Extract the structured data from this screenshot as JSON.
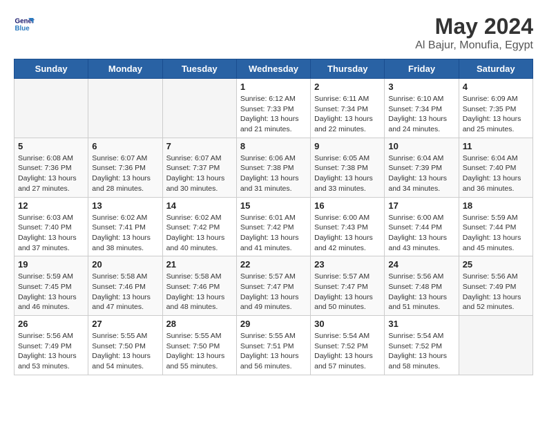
{
  "header": {
    "logo_line1": "General",
    "logo_line2": "Blue",
    "month_year": "May 2024",
    "location": "Al Bajur, Monufia, Egypt"
  },
  "days_of_week": [
    "Sunday",
    "Monday",
    "Tuesday",
    "Wednesday",
    "Thursday",
    "Friday",
    "Saturday"
  ],
  "weeks": [
    [
      {
        "day": "",
        "info": ""
      },
      {
        "day": "",
        "info": ""
      },
      {
        "day": "",
        "info": ""
      },
      {
        "day": "1",
        "info": "Sunrise: 6:12 AM\nSunset: 7:33 PM\nDaylight: 13 hours and 21 minutes."
      },
      {
        "day": "2",
        "info": "Sunrise: 6:11 AM\nSunset: 7:34 PM\nDaylight: 13 hours and 22 minutes."
      },
      {
        "day": "3",
        "info": "Sunrise: 6:10 AM\nSunset: 7:34 PM\nDaylight: 13 hours and 24 minutes."
      },
      {
        "day": "4",
        "info": "Sunrise: 6:09 AM\nSunset: 7:35 PM\nDaylight: 13 hours and 25 minutes."
      }
    ],
    [
      {
        "day": "5",
        "info": "Sunrise: 6:08 AM\nSunset: 7:36 PM\nDaylight: 13 hours and 27 minutes."
      },
      {
        "day": "6",
        "info": "Sunrise: 6:07 AM\nSunset: 7:36 PM\nDaylight: 13 hours and 28 minutes."
      },
      {
        "day": "7",
        "info": "Sunrise: 6:07 AM\nSunset: 7:37 PM\nDaylight: 13 hours and 30 minutes."
      },
      {
        "day": "8",
        "info": "Sunrise: 6:06 AM\nSunset: 7:38 PM\nDaylight: 13 hours and 31 minutes."
      },
      {
        "day": "9",
        "info": "Sunrise: 6:05 AM\nSunset: 7:38 PM\nDaylight: 13 hours and 33 minutes."
      },
      {
        "day": "10",
        "info": "Sunrise: 6:04 AM\nSunset: 7:39 PM\nDaylight: 13 hours and 34 minutes."
      },
      {
        "day": "11",
        "info": "Sunrise: 6:04 AM\nSunset: 7:40 PM\nDaylight: 13 hours and 36 minutes."
      }
    ],
    [
      {
        "day": "12",
        "info": "Sunrise: 6:03 AM\nSunset: 7:40 PM\nDaylight: 13 hours and 37 minutes."
      },
      {
        "day": "13",
        "info": "Sunrise: 6:02 AM\nSunset: 7:41 PM\nDaylight: 13 hours and 38 minutes."
      },
      {
        "day": "14",
        "info": "Sunrise: 6:02 AM\nSunset: 7:42 PM\nDaylight: 13 hours and 40 minutes."
      },
      {
        "day": "15",
        "info": "Sunrise: 6:01 AM\nSunset: 7:42 PM\nDaylight: 13 hours and 41 minutes."
      },
      {
        "day": "16",
        "info": "Sunrise: 6:00 AM\nSunset: 7:43 PM\nDaylight: 13 hours and 42 minutes."
      },
      {
        "day": "17",
        "info": "Sunrise: 6:00 AM\nSunset: 7:44 PM\nDaylight: 13 hours and 43 minutes."
      },
      {
        "day": "18",
        "info": "Sunrise: 5:59 AM\nSunset: 7:44 PM\nDaylight: 13 hours and 45 minutes."
      }
    ],
    [
      {
        "day": "19",
        "info": "Sunrise: 5:59 AM\nSunset: 7:45 PM\nDaylight: 13 hours and 46 minutes."
      },
      {
        "day": "20",
        "info": "Sunrise: 5:58 AM\nSunset: 7:46 PM\nDaylight: 13 hours and 47 minutes."
      },
      {
        "day": "21",
        "info": "Sunrise: 5:58 AM\nSunset: 7:46 PM\nDaylight: 13 hours and 48 minutes."
      },
      {
        "day": "22",
        "info": "Sunrise: 5:57 AM\nSunset: 7:47 PM\nDaylight: 13 hours and 49 minutes."
      },
      {
        "day": "23",
        "info": "Sunrise: 5:57 AM\nSunset: 7:47 PM\nDaylight: 13 hours and 50 minutes."
      },
      {
        "day": "24",
        "info": "Sunrise: 5:56 AM\nSunset: 7:48 PM\nDaylight: 13 hours and 51 minutes."
      },
      {
        "day": "25",
        "info": "Sunrise: 5:56 AM\nSunset: 7:49 PM\nDaylight: 13 hours and 52 minutes."
      }
    ],
    [
      {
        "day": "26",
        "info": "Sunrise: 5:56 AM\nSunset: 7:49 PM\nDaylight: 13 hours and 53 minutes."
      },
      {
        "day": "27",
        "info": "Sunrise: 5:55 AM\nSunset: 7:50 PM\nDaylight: 13 hours and 54 minutes."
      },
      {
        "day": "28",
        "info": "Sunrise: 5:55 AM\nSunset: 7:50 PM\nDaylight: 13 hours and 55 minutes."
      },
      {
        "day": "29",
        "info": "Sunrise: 5:55 AM\nSunset: 7:51 PM\nDaylight: 13 hours and 56 minutes."
      },
      {
        "day": "30",
        "info": "Sunrise: 5:54 AM\nSunset: 7:52 PM\nDaylight: 13 hours and 57 minutes."
      },
      {
        "day": "31",
        "info": "Sunrise: 5:54 AM\nSunset: 7:52 PM\nDaylight: 13 hours and 58 minutes."
      },
      {
        "day": "",
        "info": ""
      }
    ]
  ]
}
